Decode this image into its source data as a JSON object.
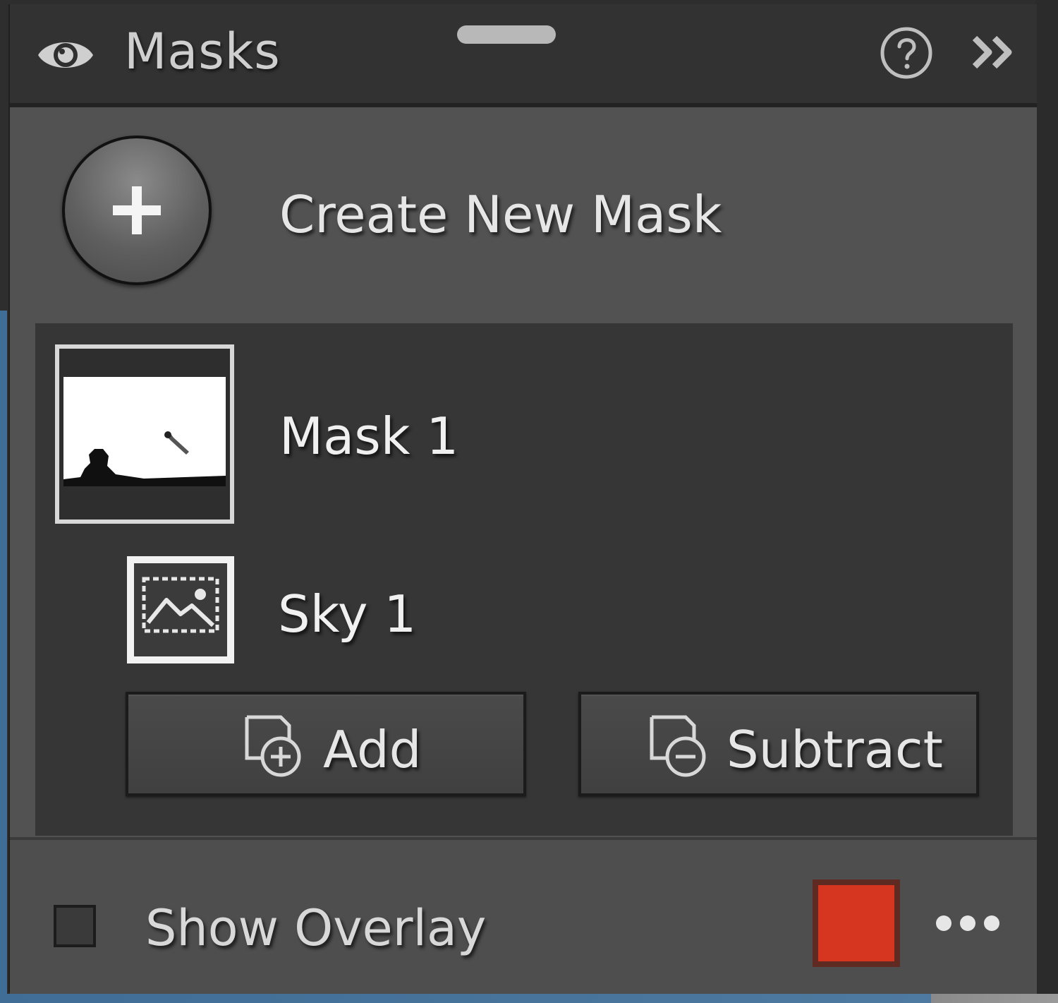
{
  "header": {
    "title": "Masks",
    "icons": {
      "visibility": "eye-icon",
      "help": "help-circle-icon",
      "collapse": "double-chevron-right-icon"
    }
  },
  "create": {
    "label": "Create New Mask",
    "icon": "plus-icon"
  },
  "masks": [
    {
      "label": "Mask 1",
      "thumbnail": "mask-preview",
      "components": [
        {
          "label": "Sky 1",
          "icon": "sky-select-icon"
        }
      ]
    }
  ],
  "actions": {
    "add_label": "Add",
    "subtract_label": "Subtract",
    "add_icon": "add-mask-icon",
    "subtract_icon": "subtract-mask-icon"
  },
  "footer": {
    "overlay_label": "Show Overlay",
    "overlay_checked": false,
    "overlay_color": "#d6361f",
    "more_icon": "more-horizontal-icon"
  }
}
